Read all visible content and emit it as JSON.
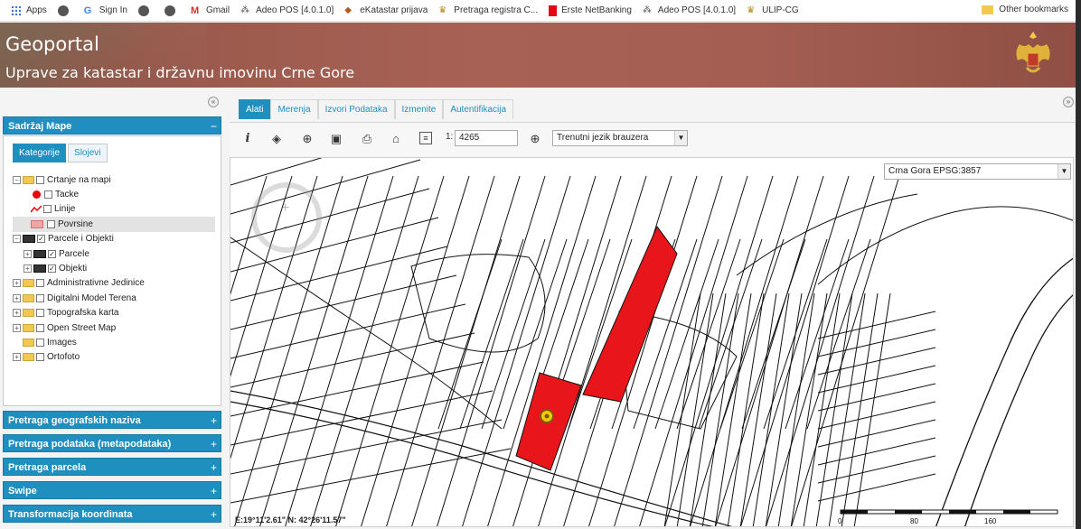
{
  "bookmarks": {
    "items": [
      {
        "label": "Apps",
        "icon": "apps-grid-icon"
      },
      {
        "label": "",
        "icon": "globe-icon"
      },
      {
        "label": "Sign In",
        "icon": "google-icon"
      },
      {
        "label": "",
        "icon": "globe-icon"
      },
      {
        "label": "",
        "icon": "globe-icon"
      },
      {
        "label": "Gmail",
        "icon": "gmail-icon"
      },
      {
        "label": "Adeo POS [4.0.1.0]",
        "icon": "adeo-icon"
      },
      {
        "label": "eKatastar prijava",
        "icon": "ekatastar-icon"
      },
      {
        "label": "Pretraga registra C...",
        "icon": "crest-icon"
      },
      {
        "label": "Erste NetBanking",
        "icon": "erste-icon"
      },
      {
        "label": "Adeo POS [4.0.1.0]",
        "icon": "adeo-icon"
      },
      {
        "label": "ULIP-CG",
        "icon": "crest-icon"
      }
    ],
    "other": "Other bookmarks"
  },
  "header": {
    "title": "Geoportal",
    "subtitle": "Uprave za katastar i državnu imovinu Crne Gore"
  },
  "left": {
    "content_title": "Sadržaj Mape",
    "tabs": [
      "Kategorije",
      "Slojevi"
    ],
    "tree": [
      {
        "label": "Crtanje na mapi",
        "kind": "folder",
        "indent": 0
      },
      {
        "label": "Tacke",
        "kind": "point",
        "indent": 1
      },
      {
        "label": "Linije",
        "kind": "line",
        "indent": 1
      },
      {
        "label": "Povrsine",
        "kind": "polygon",
        "indent": 1
      },
      {
        "label": "Parcele i Objekti",
        "kind": "layer",
        "indent": 0
      },
      {
        "label": "Parcele",
        "kind": "layer",
        "indent": 1
      },
      {
        "label": "Objekti",
        "kind": "layer",
        "indent": 1
      },
      {
        "label": "Administrativne Jedinice",
        "kind": "folder",
        "indent": 0
      },
      {
        "label": "Digitalni Model Terena",
        "kind": "folder",
        "indent": 0
      },
      {
        "label": "Topografska karta",
        "kind": "folder",
        "indent": 0
      },
      {
        "label": "Open Street Map",
        "kind": "folder",
        "indent": 0
      },
      {
        "label": "Images",
        "kind": "folder",
        "indent": 0
      },
      {
        "label": "Ortofoto",
        "kind": "folder",
        "indent": 0
      }
    ],
    "panels": [
      "Pretraga geografskih naziva",
      "Pretraga podataka (metapodataka)",
      "Pretraga parcela",
      "Swipe",
      "Transformacija koordinata"
    ]
  },
  "main": {
    "tabs": [
      "Alati",
      "Merenja",
      "Izvori Podataka",
      "Izmenite",
      "Autentifikacija"
    ],
    "scale_prefix": "1:",
    "scale_value": "4265",
    "language": "Trenutni jezik brauzera",
    "crs": "Crna Gora EPSG:3857",
    "coords": "E:19°11'2.61\"    N: 42°26'11.57\"",
    "scale_ticks": [
      "0",
      "80",
      "160"
    ]
  },
  "colors": {
    "accent": "#1f8fbf",
    "header": "#a45e52",
    "highlight_parcel": "#e8161b"
  }
}
